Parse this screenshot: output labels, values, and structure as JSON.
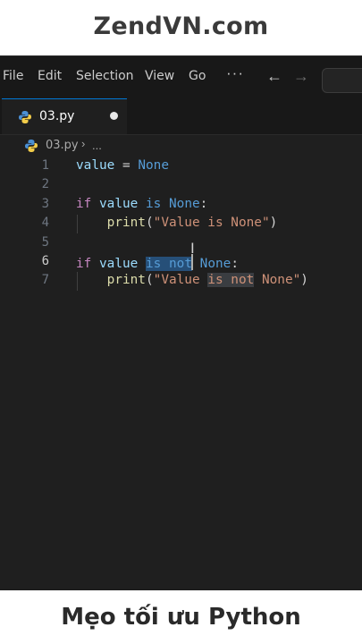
{
  "header": {
    "site": "ZendVN.com"
  },
  "footer": {
    "caption": "Mẹo tối ưu Python"
  },
  "menubar": {
    "items": [
      "File",
      "Edit",
      "Selection",
      "View",
      "Go"
    ],
    "more": "···",
    "back_icon": "arrow-left-icon",
    "forward_icon": "arrow-right-icon"
  },
  "tab": {
    "filename": "03.py",
    "icon": "python-file-icon",
    "unsaved": true
  },
  "breadcrumb": {
    "file": "03.py",
    "separator": "›",
    "more": "..."
  },
  "editor": {
    "active_line": 6,
    "selection_text": "is not",
    "lines": [
      {
        "n": "1",
        "code": "value = None"
      },
      {
        "n": "2",
        "code": ""
      },
      {
        "n": "3",
        "code": "if value is None:"
      },
      {
        "n": "4",
        "code": "    print(\"Value is None\")"
      },
      {
        "n": "5",
        "code": ""
      },
      {
        "n": "6",
        "code": "if value is not None:"
      },
      {
        "n": "7",
        "code": "    print(\"Value is not None\")"
      }
    ]
  },
  "colors": {
    "editor_bg": "#1f1f1f",
    "keyword": "#569cd6",
    "control": "#c586c0",
    "variable": "#9cdcfe",
    "function": "#dcdcaa",
    "string": "#ce9178",
    "selection": "#264f78",
    "accent": "#0078d4"
  }
}
